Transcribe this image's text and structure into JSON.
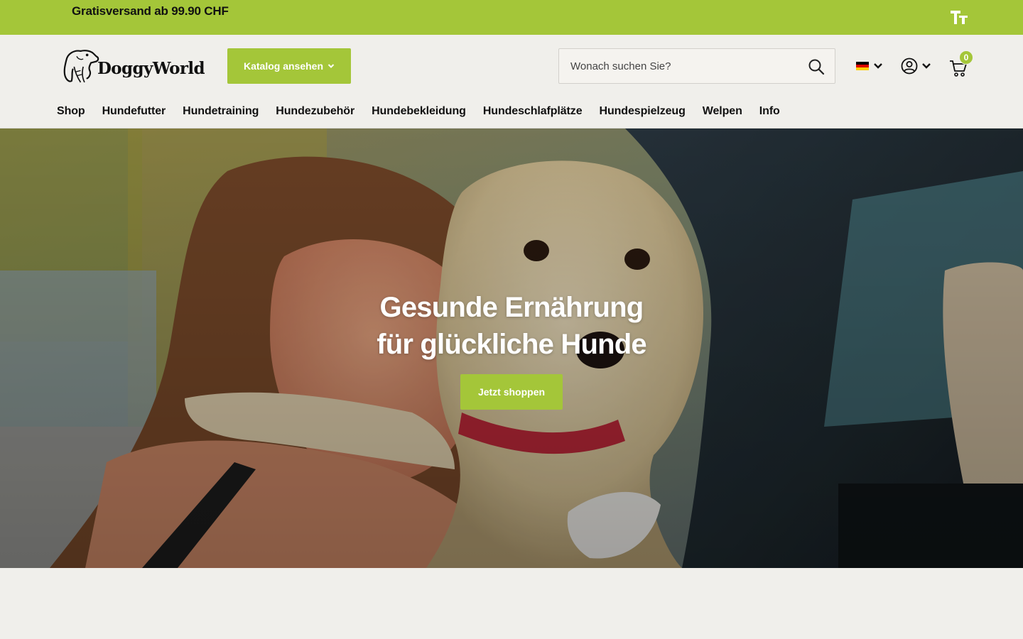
{
  "announcement": {
    "text": "Gratisversand ab 99.90 CHF",
    "text_size_icon": "text-size-icon"
  },
  "header": {
    "logo_text": "DoggyWorld",
    "catalog_button": "Katalog ansehen",
    "search": {
      "placeholder": "Wonach suchen Sie?",
      "value": ""
    },
    "language_flag": "germany-flag-icon",
    "account_icon": "user-circle-icon",
    "cart": {
      "icon": "cart-icon",
      "count": "0"
    }
  },
  "nav": {
    "items": [
      {
        "label": "Shop"
      },
      {
        "label": "Hundefutter"
      },
      {
        "label": "Hundetraining"
      },
      {
        "label": "Hundezubehör"
      },
      {
        "label": "Hundebekleidung"
      },
      {
        "label": "Hundeschlafplätze"
      },
      {
        "label": "Hundespielzeug"
      },
      {
        "label": "Welpen"
      },
      {
        "label": "Info"
      }
    ]
  },
  "hero": {
    "title_line1": "Gesunde Ernährung",
    "title_line2": "für glückliche Hunde",
    "button": "Jetzt shoppen"
  },
  "colors": {
    "accent": "#a4c639",
    "background": "#f0efeb",
    "text": "#111111"
  }
}
